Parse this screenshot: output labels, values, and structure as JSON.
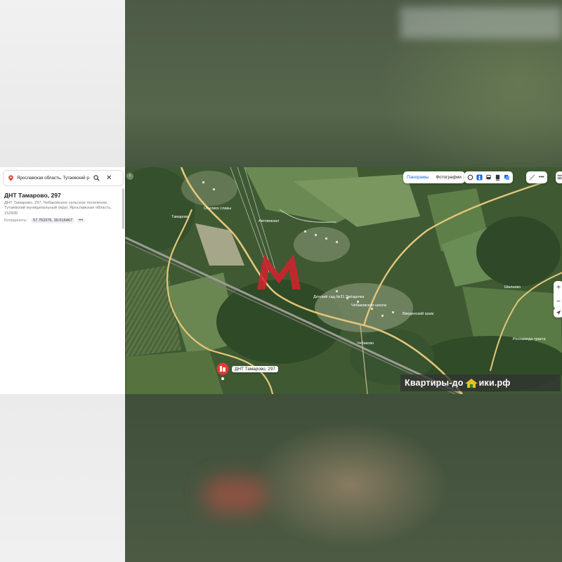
{
  "search": {
    "value": "Ярославская область, Тутаевский р-н"
  },
  "place": {
    "title": "ДНТ Тамарово, 297",
    "address": "ДНТ Тамарово, 297, Чебаковское сельское поселение, Тутаевский муниципальный округ, Ярославская область, 152935",
    "coords_label": "Координаты:",
    "coords_value": "57.752376, 39.516467",
    "coords_more": "•••"
  },
  "toolbar": {
    "panoramas": "Панорамы",
    "photos": "Фотографии",
    "more": "•••"
  },
  "zoom": {
    "plus": "+",
    "minus": "−"
  },
  "marker": {
    "label": "ДНТ Тамарово, 297"
  },
  "map_labels": [
    "Обелиск славы",
    "Автовокзал",
    "Детский сад №21 Звёздочка",
    "Чебаковская школа",
    "Роспамида тракта",
    "Тамарово",
    "Чебаково",
    "Введенский храм",
    "Шалаево"
  ],
  "watermark": {
    "text_left": "Квартиры-до",
    "text_right": "ики.рф"
  },
  "colors": {
    "accent": "#1a66d8",
    "marker": "#e53935",
    "logo": "#d6212d"
  }
}
